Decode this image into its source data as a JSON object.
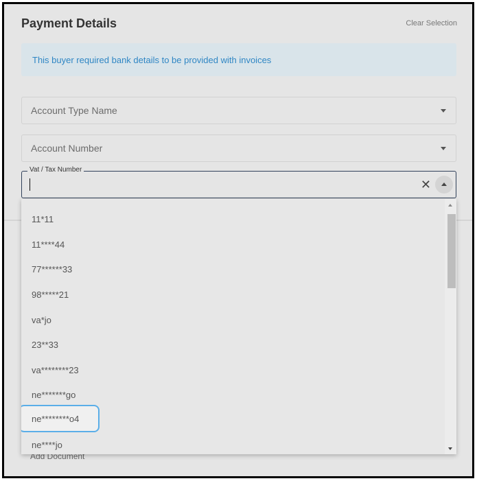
{
  "header": {
    "title": "Payment Details",
    "clear_label": "Clear Selection"
  },
  "banner": {
    "text": "This buyer required bank details to be provided with invoices"
  },
  "fields": {
    "account_type": {
      "placeholder": "Account Type Name"
    },
    "account_number": {
      "placeholder": "Account Number"
    },
    "vat": {
      "label": "Vat / Tax Number",
      "value": ""
    }
  },
  "dropdown": {
    "options": [
      "11*11",
      "11****44",
      "77******33",
      "98*****21",
      "va*jo",
      "23**33",
      "va********23",
      "ne*******go",
      "ne********o4",
      "ne****jo"
    ],
    "selected_index": 8
  },
  "background": {
    "partial_text": "Add Document"
  },
  "colors": {
    "accent": "#2f86c4",
    "selected_border": "#5aaee8",
    "focused_border": "#30405a"
  },
  "icons": {
    "clear": "close-icon",
    "toggle": "chevron-up-icon"
  }
}
